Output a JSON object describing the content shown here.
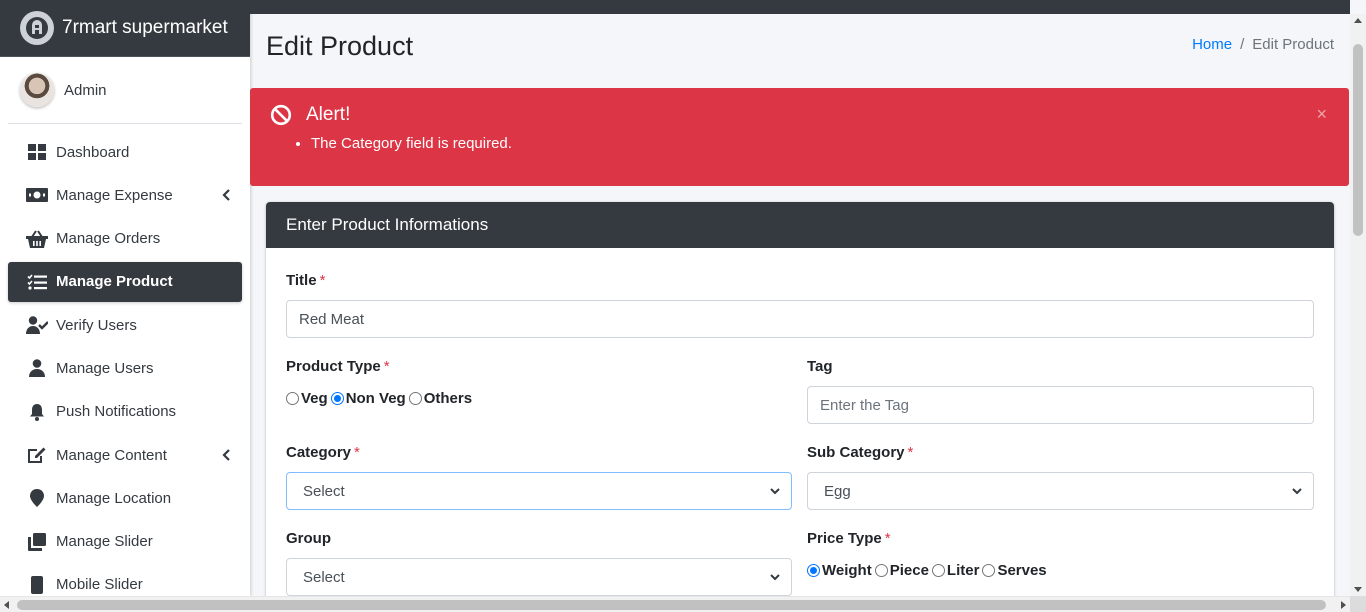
{
  "brand": {
    "name": "7rmart supermarket"
  },
  "user": {
    "name": "Admin"
  },
  "sidebar": {
    "items": [
      {
        "label": "Dashboard",
        "icon": "dashboard-icon"
      },
      {
        "label": "Manage Expense",
        "icon": "money-bill-icon",
        "expandable": true
      },
      {
        "label": "Manage Orders",
        "icon": "basket-icon"
      },
      {
        "label": "Manage Product",
        "icon": "tasks-icon",
        "active": true
      },
      {
        "label": "Verify Users",
        "icon": "user-check-icon"
      },
      {
        "label": "Manage Users",
        "icon": "user-icon"
      },
      {
        "label": "Push Notifications",
        "icon": "bell-icon"
      },
      {
        "label": "Manage Content",
        "icon": "edit-icon",
        "expandable": true
      },
      {
        "label": "Manage Location",
        "icon": "map-marker-icon"
      },
      {
        "label": "Manage Slider",
        "icon": "clone-icon"
      },
      {
        "label": "Mobile Slider",
        "icon": "mobile-icon"
      }
    ]
  },
  "header": {
    "title": "Edit Product",
    "breadcrumb": {
      "home": "Home",
      "separator": "/",
      "current": "Edit Product"
    }
  },
  "alert": {
    "title": "Alert!",
    "messages": [
      "The Category field is required."
    ],
    "close": "×"
  },
  "form": {
    "card_title": "Enter Product Informations",
    "title_label": "Title",
    "title_value": "Red Meat",
    "product_type_label": "Product Type",
    "product_type_options": [
      "Veg",
      "Non Veg",
      "Others"
    ],
    "product_type_selected": "Non Veg",
    "tag_label": "Tag",
    "tag_placeholder": "Enter the Tag",
    "category_label": "Category",
    "category_value": "Select",
    "sub_category_label": "Sub Category",
    "sub_category_value": "Egg",
    "group_label": "Group",
    "group_value": "Select",
    "price_type_label": "Price Type",
    "price_type_options": [
      "Weight",
      "Piece",
      "Liter",
      "Serves"
    ],
    "price_type_selected": "Weight",
    "required_mark": "*"
  },
  "colors": {
    "dark": "#343a40",
    "danger": "#dc3545",
    "link": "#007bff",
    "radio_checked": "#0075ff"
  }
}
